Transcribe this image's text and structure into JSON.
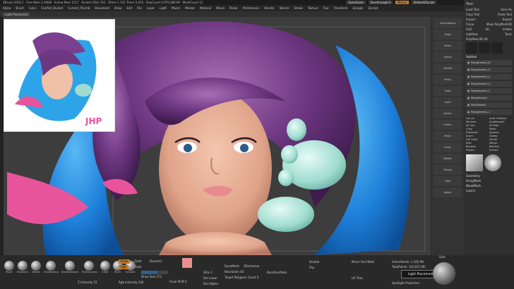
{
  "titlebar": {
    "text": "ZBrush 2018.1 · Free Mem 2.49GB · Active Mem 1217 · Scratch Disk 103 · Ztime 1.101 Timer 0.033 · PolyCount 4.976.086 KP · MeshCount 11"
  },
  "quick": {
    "quicksave": "QuickSave",
    "see_through": "See-through 0",
    "menus": "Menus",
    "default_zscript": "DefaultZScript"
  },
  "menubar": {
    "items": [
      "Alpha",
      "Brush",
      "Color",
      "Conflict_Bucket",
      "Current_Thumb",
      "Document",
      "Draw",
      "Edit",
      "File",
      "Layer",
      "Light",
      "Macro",
      "Marker",
      "Material",
      "Movie",
      "Picker",
      "Preferences",
      "Render",
      "Stencil",
      "Stroke",
      "Texture",
      "Tool",
      "Transform",
      "Zplugin",
      "Zscript"
    ]
  },
  "shelf": {
    "label": "Light Placement"
  },
  "ref": {
    "initials": "JHP"
  },
  "viewtools": {
    "items": [
      "Anti-Aliasing",
      "Snap",
      "Zoom",
      "Actual",
      "AAHalf",
      "Persp",
      "Floor",
      "Local",
      "Gizmo",
      "Frame",
      "Move",
      "Scale",
      "Rotate",
      "Transp",
      "Solo",
      "Xpose"
    ]
  },
  "palette": {
    "title": "Tool",
    "rows": [
      [
        "Load Tool",
        "Save As"
      ],
      [
        "Copy Tool",
        "Paste Tool"
      ],
      [
        "Import",
        "Export"
      ],
      [
        "Clone",
        "Make PolyMesh3D"
      ],
      [
        "GoZ",
        "All",
        "Visible"
      ],
      [
        "Lightbox",
        "Tools"
      ]
    ],
    "polymesh": "PolyMesh3D 46",
    "subtool_title": "Subtool",
    "subtools": [
      "Polyspheres1_6",
      "Polyspheres1_5",
      "Polyspheres1_4",
      "Polyspheres1_3",
      "Polyspheres1_2",
      "Polyspheres1",
      "PolySphere1",
      "Polyspheres1_1"
    ],
    "actions": [
      "List All",
      "Auto Collapse",
      "Rename",
      "AutoReorder",
      "All Low",
      "All High",
      "Copy",
      "Paste",
      "Duplicate",
      "Append",
      "Insert",
      "Delete",
      "Del Other",
      "Del All",
      "Split",
      "Merge",
      "Boolean",
      "Remesh",
      "Project",
      "Extract"
    ],
    "bottom": [
      "Geometry",
      "ArrayMesh",
      "NanoMesh",
      "Layers"
    ]
  },
  "brushes": {
    "items": [
      "Move",
      "Standard",
      "hPolish",
      "ClayBuildup",
      "DamStandard",
      "TrimDynamic",
      "Inflat",
      "Pinch",
      "Smooth"
    ]
  },
  "bottom": {
    "draw": "Draw",
    "rgb": "Rgb",
    "zadd": "Zadd",
    "zsub": "Zsub",
    "rgb_intensity": "Rgb Intensity 100",
    "z_intensity": "Z Intensity 51",
    "draw_size": "Draw Size 273",
    "focal_shift": "Focal Shift 0",
    "dynamic": "Dynamic",
    "dynamesh": "DynaMesh",
    "zremesher": "ZRemesher",
    "resolution": "Resolution 64",
    "target_polygons": "Target Polygons Count 5",
    "sdiv": "SDiv 1",
    "del_lower": "Del Lower",
    "del_higher": "Del Higher",
    "backface": "BackfaceMask",
    "mirror_weld": "Mirror And Weld",
    "double": "Double",
    "flip": "Flip",
    "active_points": "ActivePoints: 1.205 Mil",
    "total_points": "TotalPoints: 116.615 Mil",
    "spotlight_proj": "Spotlight Projection",
    "use_poly": "UV Tiles",
    "sphere_view": "Solo",
    "tooltip": "Light Placement"
  },
  "colors": {
    "accent": "#c27a2b",
    "viewport": "#3d3d3d",
    "blue_hair": "#1f8fe0",
    "pink": "#e8549c",
    "skin": "#e8b49a",
    "purple_hair": "#7a3f8f",
    "mint": "#a8e0d4"
  }
}
